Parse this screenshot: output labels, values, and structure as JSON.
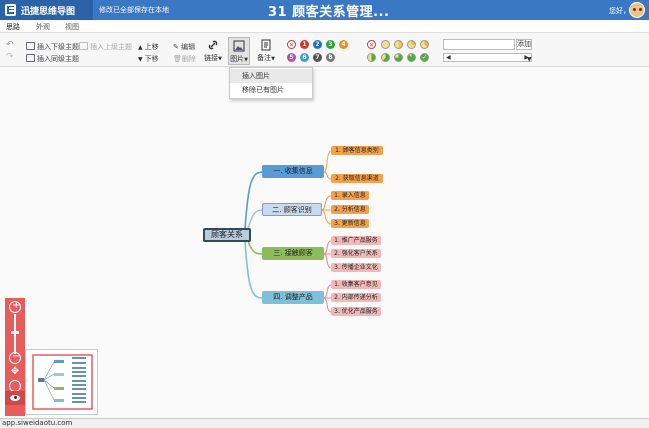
{
  "app": {
    "name": "迅捷思维导图",
    "save_status": "修改已全部保存在本地",
    "doc_title": "31 顾客关系管理...",
    "greeting": "您好，"
  },
  "tabs": [
    "思路",
    "外观",
    "视图"
  ],
  "toolbar": {
    "insert_child": "插入下级主题",
    "insert_parent": "插入上级主题",
    "insert_sibling": "插入同级主题",
    "move_up": "上移",
    "move_down": "下移",
    "edit": "编辑",
    "delete": "删除",
    "link": "链接",
    "image": "图片",
    "note": "备注",
    "priority_labels": [
      "1",
      "2",
      "3",
      "4",
      "5",
      "6",
      "7",
      "8"
    ],
    "add": "添加"
  },
  "image_menu": {
    "insert_image": "插入图片",
    "remove_image": "移除已有图片"
  },
  "mindmap": {
    "root": "顾客关系",
    "branches": [
      {
        "label": "一. 收集信息",
        "items": [
          "1. 顾客信息类别",
          "2. 获取信息渠道"
        ]
      },
      {
        "label": "二. 顾客识别",
        "items": [
          "1. 录入信息",
          "2. 分析信息",
          "3. 更新信息"
        ]
      },
      {
        "label": "三. 接触顾客",
        "items": [
          "1. 推广产品服务",
          "2. 强化客户关系",
          "3. 传播企业文化"
        ]
      },
      {
        "label": "四. 调整产品",
        "items": [
          "1. 收集客户意见",
          "2. 内部传递分析",
          "3. 优化产品服务"
        ]
      }
    ]
  },
  "colors": {
    "brand": "#3a78c4",
    "branch1": "#5b9bd5",
    "branch2": "#c9d9ee",
    "branch3": "#8fbc5a",
    "branch4": "#7ec0d8",
    "leaf_orange": "#f4a14b",
    "leaf_pink": "#f2b8b8",
    "zoom_panel": "#e85c5c"
  },
  "status_url": "app.siweidaotu.com"
}
